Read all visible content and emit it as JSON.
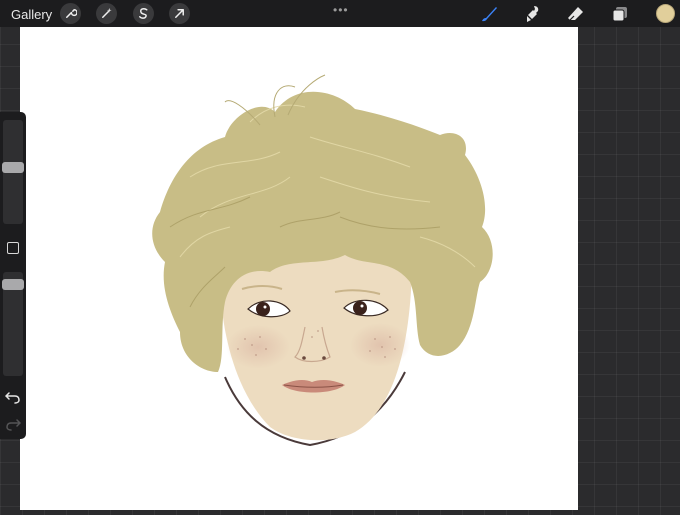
{
  "topbar": {
    "gallery_label": "Gallery",
    "left_tools": [
      {
        "icon": "wrench-icon",
        "name": "actions-button"
      },
      {
        "icon": "magic-wand-icon",
        "name": "adjustments-button"
      },
      {
        "icon": "selection-s-icon",
        "name": "selection-button"
      },
      {
        "icon": "arrow-cursor-icon",
        "name": "transform-button"
      }
    ],
    "center_dots": "•••",
    "right_tools": [
      {
        "icon": "brush-icon",
        "name": "brush-button",
        "active": true
      },
      {
        "icon": "smudge-icon",
        "name": "smudge-button",
        "active": false
      },
      {
        "icon": "eraser-icon",
        "name": "eraser-button",
        "active": false
      },
      {
        "icon": "layers-icon",
        "name": "layers-button",
        "active": false
      }
    ],
    "active_color": "#e1cf9b"
  },
  "sidebar": {
    "brush_size_level": 0.55,
    "opacity_level": 0.93
  },
  "colors": {
    "hair": "#c8bd86",
    "skin": "#eddcc0",
    "lips": "#c98a7a",
    "accent_brush": "#3b82f6"
  }
}
